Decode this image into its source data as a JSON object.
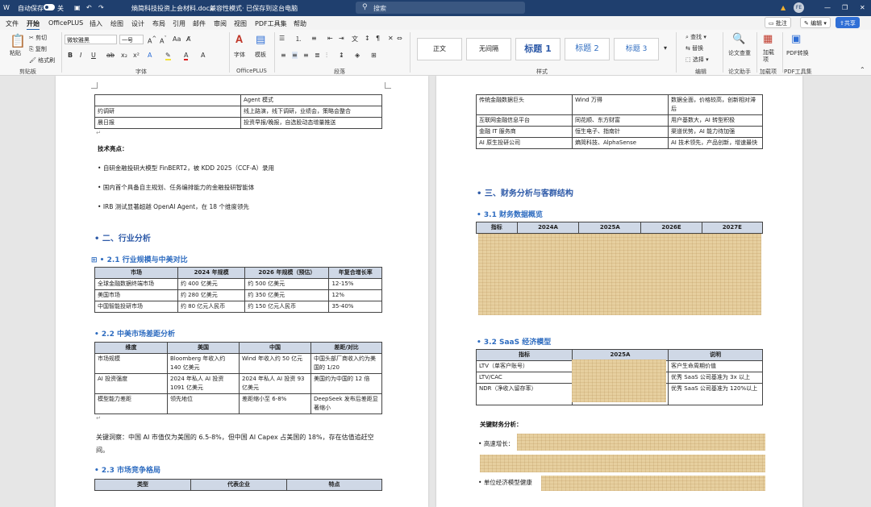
{
  "titlebar": {
    "autosave": "自动保存",
    "toggle": "关",
    "doc": "熵简科技投资上会材料.docx",
    "sep": "·",
    "mode": "兼容性模式",
    "saved": "· 已保存到这台电脑",
    "search": "搜索",
    "avatar": "FE"
  },
  "menu": [
    "文件",
    "开始",
    "OfficePLUS",
    "插入",
    "绘图",
    "设计",
    "布局",
    "引用",
    "邮件",
    "审阅",
    "视图",
    "PDF工具集",
    "帮助"
  ],
  "menu_actions": {
    "comment": "批注",
    "edit": "编辑",
    "share": "共享"
  },
  "ribbon": {
    "paste": "粘贴",
    "cut": "剪切",
    "copy": "复制",
    "painter": "格式刷",
    "clipboard": "剪贴板",
    "font_name": "微软雅黑",
    "font_size": "一号",
    "font_label": "字体",
    "font_group_btn": "字体",
    "template_btn": "模板",
    "officeplus_label": "OfficePLUS",
    "para_label": "段落",
    "styles": [
      "正文",
      "无间隔",
      "标题 1",
      "标题 2",
      "标题 3"
    ],
    "styles_label": "样式",
    "find": "查找",
    "replace": "替换",
    "select": "选择",
    "editing_label": "编辑",
    "check": "论文查重",
    "check_label": "论文助手",
    "addin": "加载项",
    "addin_label": "加载项",
    "pdf": "PDF转换",
    "pdf_label": "PDF工具集"
  },
  "left": {
    "top_rows": [
      [
        "",
        "Agent 模式"
      ],
      [
        "约调研",
        "线上路演，线下调研，业绩会，策略会整合"
      ],
      [
        "晨日报",
        "投资早报/晚报，自选股动态增量推送"
      ]
    ],
    "tech_title": "技术亮点：",
    "bullets": [
      "自研金融投研大模型 FinBERT2，被 KDD 2025（CCF-A）录用",
      "国内首个具备自主规划、任务编排能力的金融投研智能体",
      "IRB 测试显著超越 OpenAI Agent，在 18 个维度领先"
    ],
    "h_industry": "二、行业分析",
    "h_21": "2.1 行业规模与中美对比",
    "t21_head": [
      "市场",
      "2024 年规模",
      "2026 年规模（预估）",
      "年复合增长率"
    ],
    "t21_rows": [
      [
        "全球金融数据终端市场",
        "约 400 亿美元",
        "约 500 亿美元",
        "12-15%"
      ],
      [
        "美国市场",
        "约 280 亿美元",
        "约 350 亿美元",
        "12%"
      ],
      [
        "中国智能投研市场",
        "约 80 亿元人民币",
        "约 150 亿元人民币",
        "35-40%"
      ]
    ],
    "h_22": "2.2 中美市场差距分析",
    "t22_head": [
      "维度",
      "美国",
      "中国",
      "差距/对比"
    ],
    "t22_rows": [
      [
        "市场规模",
        "Bloomberg 年收入约 140 亿美元",
        "Wind 年收入约 50 亿元",
        "中国头部厂商收入约为美国的 1/20"
      ],
      [
        "AI 投资强度",
        "2024 年私人 AI 投资 1091 亿美元",
        "2024 年私人 AI 投资 93 亿美元",
        "美国约为中国的 12 倍"
      ],
      [
        "模型能力差距",
        "领先地位",
        "差距缩小至 6-8%",
        "DeepSeek 发布后差距显著缩小"
      ]
    ],
    "insight": "关键洞察：中国 AI 市值仅为美国的 6.5-8%，但中国 AI Capex 占美国的 18%，存在估值追赶空",
    "insight2": "间。",
    "h_23": "2.3 市场竞争格局",
    "t23_head": [
      "类型",
      "代表企业",
      "特点"
    ]
  },
  "right": {
    "top_rows": [
      [
        "传统金融数据巨头",
        "Wind 万得",
        "数据全面，价格较高，创新相对滞后"
      ],
      [
        "互联网金融信息平台",
        "同花顺、东方财富",
        "用户基数大，AI 转型积极"
      ],
      [
        "金融 IT 服务商",
        "恒生电子、指南针",
        "渠道优势，AI 能力待加强"
      ],
      [
        "AI 原生投研公司",
        "熵简科技、AlphaSense",
        "AI 技术领先，产品创新，增速最快"
      ]
    ],
    "h_fin": "三、财务分析与客群结构",
    "h_31": "3.1 财务数据概览",
    "t31_head": [
      "指标",
      "2024A",
      "2025A",
      "2026E",
      "2027E"
    ],
    "h_32": "3.2 SaaS 经济模型",
    "t32_head": [
      "指标",
      "2025A",
      "说明"
    ],
    "t32_rows": [
      [
        "LTV（单客户账号）",
        "客户生命周期价值"
      ],
      [
        "LTV/CAC",
        "优秀 SaaS 公司基准为 3x 以上"
      ],
      [
        "NDR（净收入留存率）",
        "优秀 SaaS 公司基准为 120%以上"
      ]
    ],
    "key_fin": "关键财务分析：",
    "b_growth": "高速增长：",
    "b_unit": "单位经济模型健康"
  }
}
